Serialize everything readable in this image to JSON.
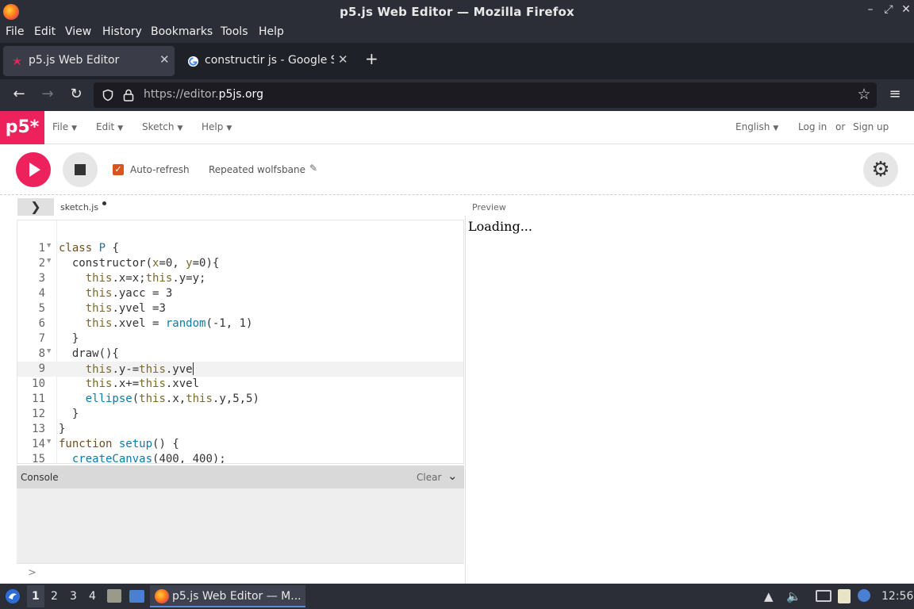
{
  "window": {
    "title": "p5.js Web Editor — Mozilla Firefox",
    "controls": [
      "–",
      "⤢",
      "✕"
    ]
  },
  "menubar": [
    "File",
    "Edit",
    "View",
    "History",
    "Bookmarks",
    "Tools",
    "Help"
  ],
  "tabs": [
    {
      "label": "p5.js Web Editor",
      "active": true
    },
    {
      "label": "constructir js - Google Se",
      "active": false
    }
  ],
  "newtab": "+",
  "nav": {
    "url_prefix": "https://editor.",
    "url_domain": "p5js.org"
  },
  "p5": {
    "logo": "p5*",
    "menu": [
      "File",
      "Edit",
      "Sketch",
      "Help"
    ],
    "language": "English",
    "login": "Log in",
    "or": "or",
    "signup": "Sign up"
  },
  "toolbar": {
    "auto_refresh_label": "Auto-refresh",
    "auto_refresh_checked": true,
    "sketch_name": "Repeated wolfsbane"
  },
  "file": {
    "name": "sketch.js",
    "preview_label": "Preview"
  },
  "editor": {
    "lines": [
      {
        "n": "1",
        "fold": true
      },
      {
        "n": "2",
        "fold": true
      },
      {
        "n": "3",
        "fold": false
      },
      {
        "n": "4",
        "fold": false
      },
      {
        "n": "5",
        "fold": false
      },
      {
        "n": "6",
        "fold": false
      },
      {
        "n": "7",
        "fold": false
      },
      {
        "n": "8",
        "fold": true
      },
      {
        "n": "9",
        "fold": false
      },
      {
        "n": "10",
        "fold": false
      },
      {
        "n": "11",
        "fold": false
      },
      {
        "n": "12",
        "fold": false
      },
      {
        "n": "13",
        "fold": false
      },
      {
        "n": "14",
        "fold": true
      },
      {
        "n": "15",
        "fold": false
      }
    ],
    "active_line": 9
  },
  "console": {
    "title": "Console",
    "clear": "Clear",
    "prompt": ">"
  },
  "preview": {
    "loading": "Loading..."
  },
  "taskbar": {
    "workspaces": [
      "1",
      "2",
      "3",
      "4"
    ],
    "window_label": "p5.js Web Editor — M...",
    "clock": "12:56"
  }
}
